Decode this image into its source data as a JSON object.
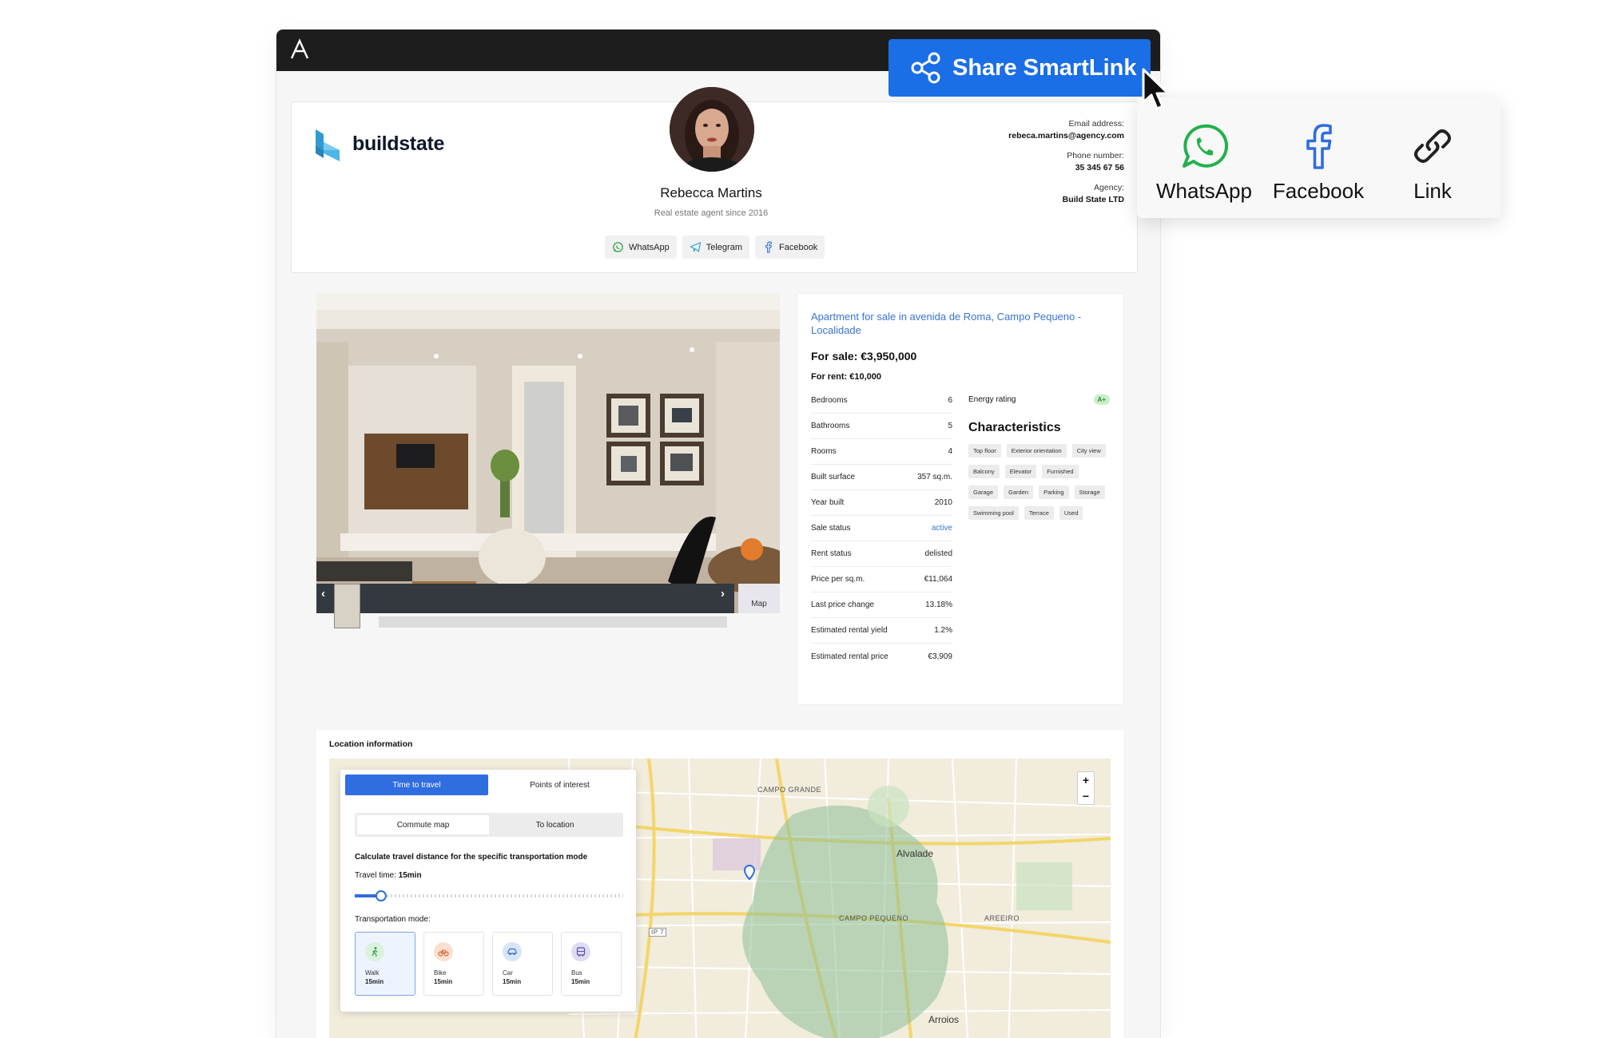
{
  "share": {
    "button_label": "Share SmartLink",
    "options": [
      {
        "label": "WhatsApp",
        "icon": "whatsapp-icon"
      },
      {
        "label": "Facebook",
        "icon": "facebook-icon"
      },
      {
        "label": "Link",
        "icon": "link-icon"
      }
    ]
  },
  "agent": {
    "brand": "buildstate",
    "name": "Rebecca Martins",
    "subtitle": "Real estate agent since 2016",
    "socials": [
      "WhatsApp",
      "Telegram",
      "Facebook"
    ],
    "email_label": "Email address:",
    "email": "rebeca.martins@agency.com",
    "phone_label": "Phone number:",
    "phone": "35 345 67 56",
    "agency_label": "Agency:",
    "agency": "Build State LTD"
  },
  "gallery": {
    "map_label": "Map"
  },
  "listing": {
    "title": "Apartment for sale in avenida de Roma, Campo Pequeno - Localidade",
    "price_sale": "For sale: €3,950,000",
    "price_rent": "For rent: €10,000",
    "facts": [
      {
        "label": "Bedrooms",
        "value": "6"
      },
      {
        "label": "Bathrooms",
        "value": "5"
      },
      {
        "label": "Rooms",
        "value": "4"
      },
      {
        "label": "Built surface",
        "value": "357 sq.m."
      },
      {
        "label": "Year built",
        "value": "2010"
      },
      {
        "label": "Sale status",
        "value": "active"
      },
      {
        "label": "Rent status",
        "value": "delisted"
      },
      {
        "label": "Price per sq.m.",
        "value": "€11,064"
      },
      {
        "label": "Last price change",
        "value": "13.18%"
      },
      {
        "label": "Estimated rental yield",
        "value": "1.2%"
      },
      {
        "label": "Estimated rental price",
        "value": "€3,909"
      }
    ],
    "energy_label": "Energy rating",
    "energy_value": "A+",
    "characteristics_title": "Characteristics",
    "characteristics": [
      "Top floor",
      "Exterior orientation",
      "City view",
      "Balcony",
      "Elevator",
      "Furnished",
      "Garage",
      "Garden",
      "Parking",
      "Storage",
      "Swimming pool",
      "Terrace",
      "Used"
    ]
  },
  "location": {
    "title": "Location information",
    "tabs": [
      "Time to travel",
      "Points of interest"
    ],
    "segments": [
      "Commute map",
      "To location"
    ],
    "calc_title": "Calculate travel distance for the specific transportation mode",
    "travel_time_label": "Travel time:",
    "travel_time_value": "15min",
    "slider_fraction": 0.08,
    "modes_title": "Transportation mode:",
    "modes": [
      {
        "name": "Walk",
        "time": "15min",
        "color": "#5cc06b",
        "bg": "#d8f2dc"
      },
      {
        "name": "Bike",
        "time": "15min",
        "color": "#e5814a",
        "bg": "#fbe0d1"
      },
      {
        "name": "Car",
        "time": "15min",
        "color": "#4b7fd1",
        "bg": "#d8e5f8"
      },
      {
        "name": "Bus",
        "time": "15min",
        "color": "#6e64b8",
        "bg": "#dedbf4"
      }
    ],
    "map_labels": [
      "CAMPO GRANDE",
      "Alvalade",
      "CAMPO PEQUENO",
      "AREEIRO",
      "Arroios",
      "IP 7"
    ],
    "zoom_in": "+",
    "zoom_out": "−"
  }
}
